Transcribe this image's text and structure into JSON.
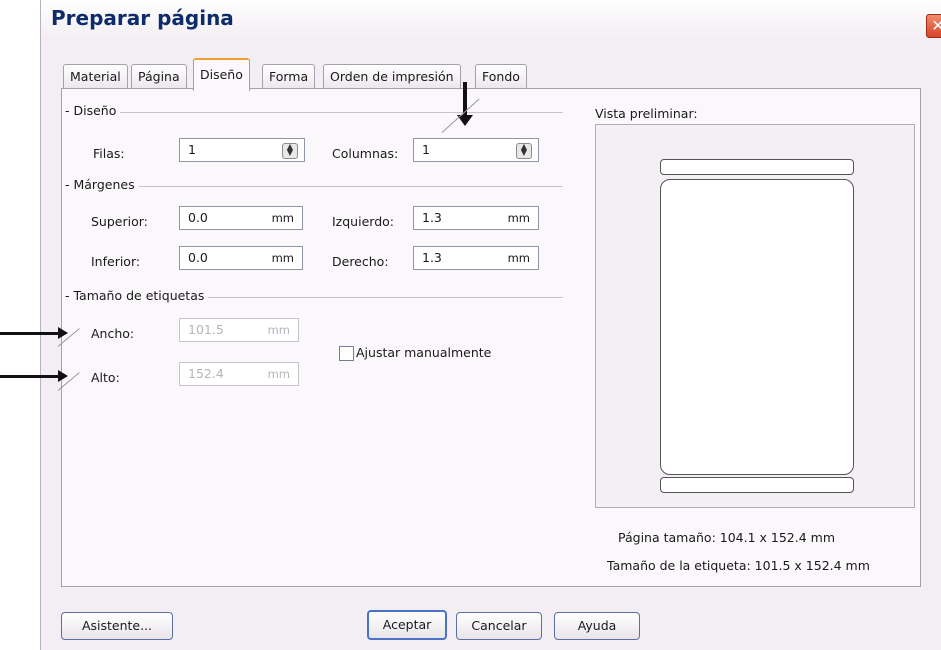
{
  "window": {
    "title": "Preparar página",
    "close_glyph": "✕"
  },
  "tabs": [
    {
      "label": "Material",
      "active": false
    },
    {
      "label": "Página",
      "active": false
    },
    {
      "label": "Diseño",
      "active": true
    },
    {
      "label": "Forma",
      "active": false
    },
    {
      "label": "Orden de impresión",
      "active": false
    },
    {
      "label": "Fondo",
      "active": false
    }
  ],
  "diseno": {
    "group": "Diseño",
    "filas": {
      "label": "Filas:",
      "value": "1"
    },
    "columnas": {
      "label": "Columnas:",
      "value": "1"
    }
  },
  "margenes": {
    "group": "Márgenes",
    "superior": {
      "label": "Superior:",
      "value": "0.0",
      "unit": "mm"
    },
    "inferior": {
      "label": "Inferior:",
      "value": "0.0",
      "unit": "mm"
    },
    "izquierdo": {
      "label": "Izquierdo:",
      "value": "1.3",
      "unit": "mm"
    },
    "derecho": {
      "label": "Derecho:",
      "value": "1.3",
      "unit": "mm"
    }
  },
  "tamano": {
    "group": "Tamaño de etiquetas",
    "ancho": {
      "label": "Ancho:",
      "value": "101.5",
      "unit": "mm"
    },
    "alto": {
      "label": "Alto:",
      "value": "152.4",
      "unit": "mm"
    },
    "ajustar": {
      "label": "Ajustar manualmente",
      "checked": false
    }
  },
  "preview": {
    "label": "Vista preliminar:",
    "pagina_tamano": "Página tamaño:  104.1 x 152.4  mm",
    "etiqueta_tamano": "Tamaño de la etiqueta:  101.5 x 152.4  mm"
  },
  "buttons": {
    "asistente": "Asistente...",
    "aceptar": "Aceptar",
    "cancelar": "Cancelar",
    "ayuda": "Ayuda"
  },
  "colors": {
    "title": "#0e2c6a",
    "accent_tab": "#f0a030",
    "close": "#d9442a"
  },
  "icons": [
    "close-icon",
    "spinner-icon",
    "arrow-annotation-icon"
  ]
}
